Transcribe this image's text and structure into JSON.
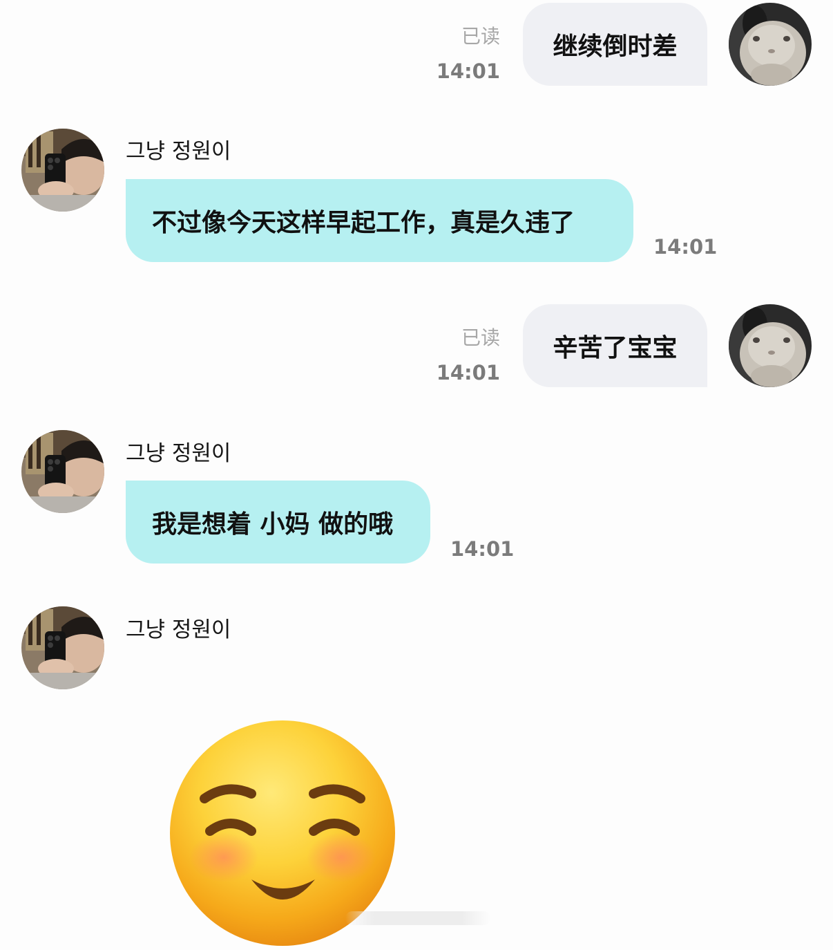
{
  "contact": {
    "name": "그냥 정원이"
  },
  "messages": [
    {
      "direction": "outgoing",
      "text": "继续倒时差",
      "read_label": "已读",
      "time": "14:01"
    },
    {
      "direction": "incoming",
      "text": "不过像今天这样早起工作，真是久违了",
      "time": "14:01"
    },
    {
      "direction": "outgoing",
      "text": "辛苦了宝宝",
      "read_label": "已读",
      "time": "14:01"
    },
    {
      "direction": "incoming",
      "text": "我是想着 小妈 做的哦",
      "time": "14:01"
    }
  ],
  "sticker": {
    "icon": "smiling-face-with-smiling-eyes-icon"
  },
  "colors": {
    "incoming_bubble": "#b6f0f1",
    "outgoing_bubble": "#eff0f4",
    "background": "#fdfdfd",
    "read_label": "#a7a7a7",
    "time": "#7b7b7b"
  }
}
